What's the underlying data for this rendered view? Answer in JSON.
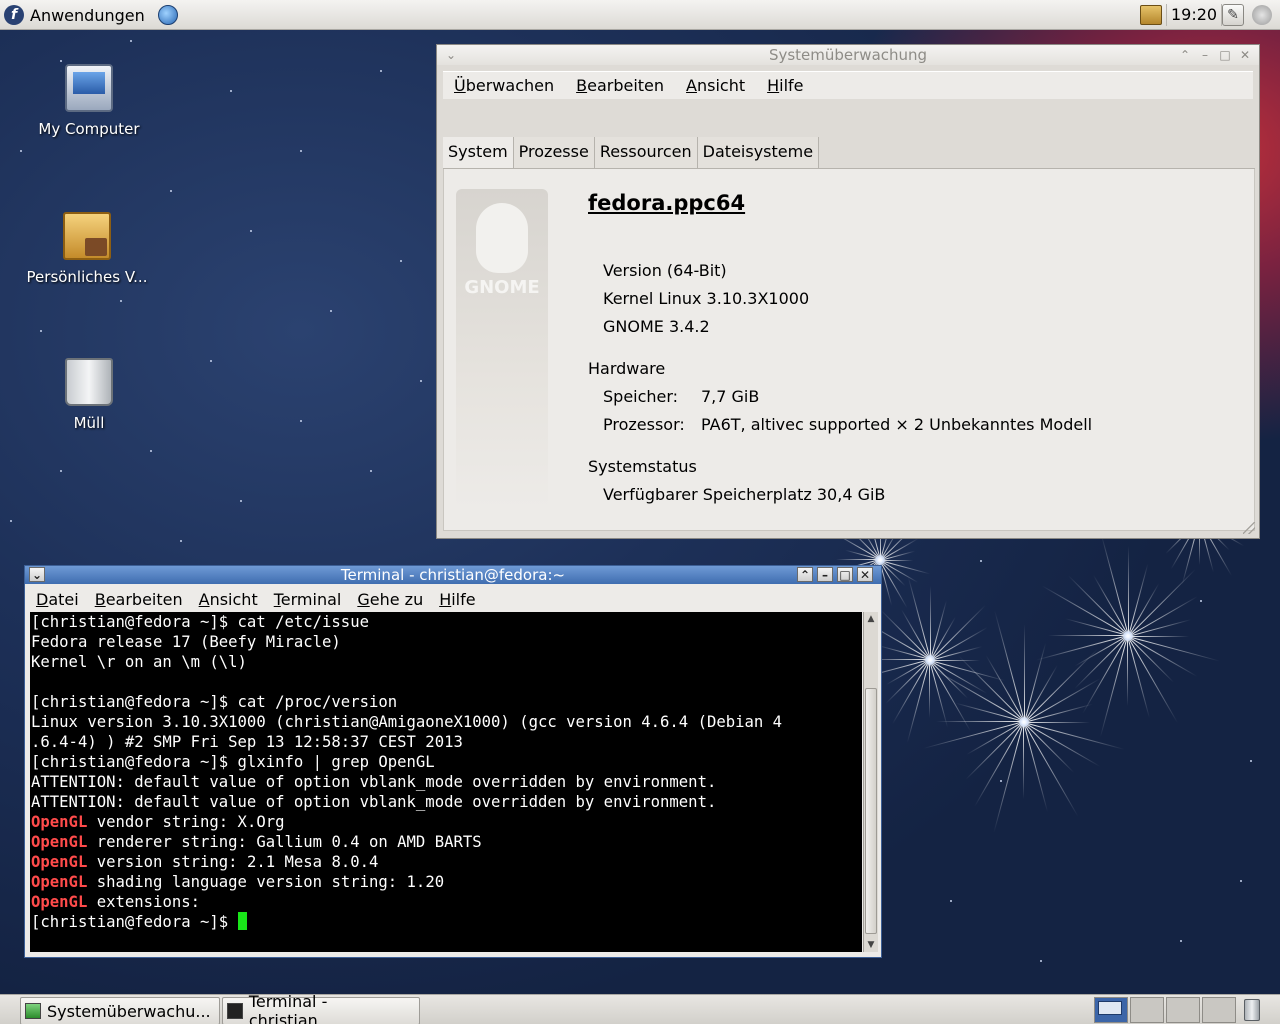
{
  "top_panel": {
    "apps_label": "Anwendungen",
    "clock": "19:20"
  },
  "desktop_icons": [
    {
      "label": "My Computer"
    },
    {
      "label": "Persönliches V..."
    },
    {
      "label": "Müll"
    }
  ],
  "sysmon": {
    "title": "Systemüberwachung",
    "menu": [
      "Überwachen",
      "Bearbeiten",
      "Ansicht",
      "Hilfe"
    ],
    "tabs": [
      "System",
      "Prozesse",
      "Ressourcen",
      "Dateisysteme"
    ],
    "active_tab": "System",
    "logo_text": "GNOME",
    "hostname": "fedora.ppc64",
    "version": "Version  (64-Bit)",
    "kernel": "Kernel Linux 3.10.3X1000",
    "gnome": "GNOME 3.4.2",
    "hardware_head": "Hardware",
    "memory_label": "Speicher:",
    "memory_value": "7,7 GiB",
    "cpu_label": "Prozessor:",
    "cpu_value": "PA6T, altivec supported × 2 Unbekanntes Modell",
    "status_head": "Systemstatus",
    "disk": "Verfügbarer Speicherplatz  30,4 GiB"
  },
  "terminal": {
    "title": "Terminal - christian@fedora:~",
    "menu": [
      "Datei",
      "Bearbeiten",
      "Ansicht",
      "Terminal",
      "Gehe zu",
      "Hilfe"
    ],
    "lines": [
      "[christian@fedora ~]$ cat /etc/issue",
      "Fedora release 17 (Beefy Miracle)",
      "Kernel \\r on an \\m (\\l)",
      "",
      "[christian@fedora ~]$ cat /proc/version",
      "Linux version 3.10.3X1000 (christian@AmigaoneX1000) (gcc version 4.6.4 (Debian 4",
      ".6.4-4) ) #2 SMP Fri Sep 13 12:58:37 CEST 2013",
      "[christian@fedora ~]$ glxinfo | grep OpenGL",
      "ATTENTION: default value of option vblank_mode overridden by environment.",
      "ATTENTION: default value of option vblank_mode overridden by environment."
    ],
    "opengl_keyword": "OpenGL",
    "opengl_lines": [
      " vendor string: X.Org",
      " renderer string: Gallium 0.4 on AMD BARTS",
      " version string: 2.1 Mesa 8.0.4",
      " shading language version string: 1.20",
      " extensions:"
    ],
    "prompt": "[christian@fedora ~]$ "
  },
  "taskbar": {
    "items": [
      "Systemüberwachu...",
      "Terminal - christian..."
    ]
  },
  "colors": {
    "opengl_highlight": "#ff4b4b",
    "cursor": "#19e619",
    "titlebar_active": "#3f6db0"
  }
}
